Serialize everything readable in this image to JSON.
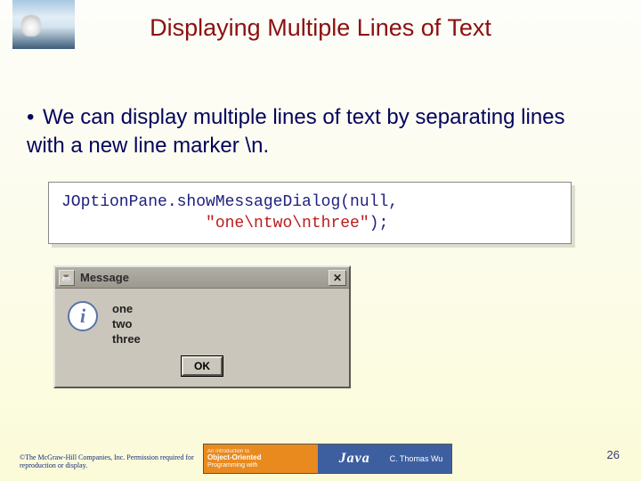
{
  "thumb_alt": "mountain/geyser photograph",
  "title": "Displaying Multiple Lines of Text",
  "bullet_text": "We can display multiple lines of text by separating lines with a new line marker \\n.",
  "code": {
    "call": "JOptionPane.showMessageDialog(null,",
    "string_literal": "\"one\\ntwo\\nthree\"",
    "terminator": ");"
  },
  "dialog": {
    "title": "Message",
    "icon_label": "i",
    "lines": [
      "one",
      "two",
      "three"
    ],
    "ok_label": "OK",
    "close_symbol": "✕",
    "java_cup_symbol": "☕"
  },
  "footer": {
    "copyright": "©The McGraw-Hill Companies, Inc. Permission required for reproduction or display.",
    "book_top": "An Introduction to",
    "book_main": "Object-Oriented",
    "book_sub": "Programming with",
    "book_java": "Java",
    "book_author": "C. Thomas Wu",
    "page_number": "26"
  }
}
